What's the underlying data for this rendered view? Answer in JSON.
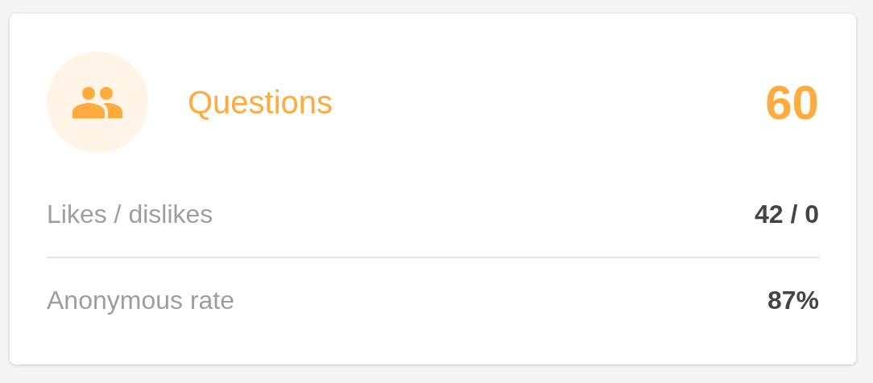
{
  "card": {
    "title": "Questions",
    "value": "60",
    "stats": [
      {
        "label": "Likes / dislikes",
        "value": "42 / 0"
      },
      {
        "label": "Anonymous rate",
        "value": "87%"
      }
    ]
  }
}
